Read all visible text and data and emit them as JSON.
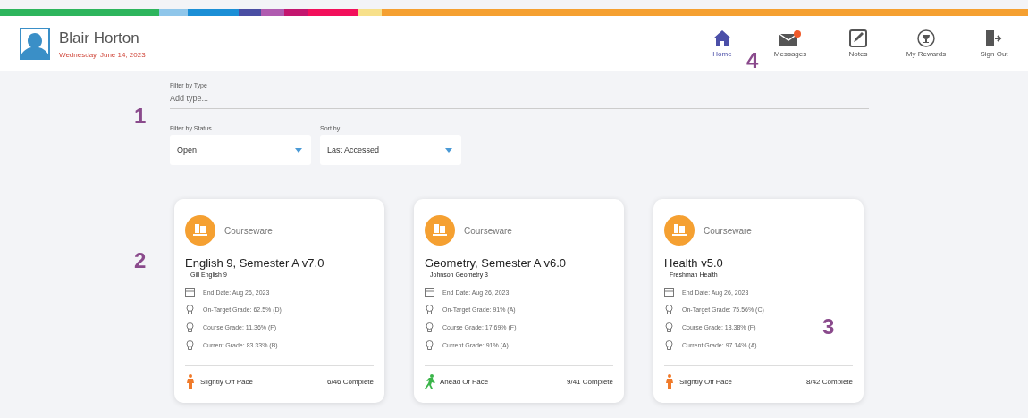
{
  "user": {
    "name": "Blair Horton",
    "date": "Wednesday, June 14, 2023"
  },
  "nav": [
    {
      "label": "Home",
      "kind": "home",
      "selected": true
    },
    {
      "label": "Messages",
      "kind": "messages",
      "selected": false,
      "unread": true
    },
    {
      "label": "Notes",
      "kind": "notes",
      "selected": false
    },
    {
      "label": "My Rewards",
      "kind": "rewards",
      "selected": false
    },
    {
      "label": "Sign Out",
      "kind": "signout",
      "selected": false
    }
  ],
  "filters": {
    "type_label": "Filter by Type",
    "type_placeholder": "Add type...",
    "status_label": "Filter by Status",
    "status_value": "Open",
    "sort_label": "Sort by",
    "sort_value": "Last Accessed"
  },
  "cards": [
    {
      "category": "Courseware",
      "title": "English 9, Semester A v7.0",
      "subtitle": "Gill English 9",
      "end_date": "End Date: Aug 26, 2023",
      "on_target": "On-Target Grade: 62.5% (D)",
      "course_grade": "Course Grade: 11.36% (F)",
      "current_grade": "Current Grade: 83.33% (B)",
      "pace": "Slightly Off Pace",
      "kind": "off",
      "complete": "6/46 Complete"
    },
    {
      "category": "Courseware",
      "title": "Geometry, Semester A v6.0",
      "subtitle": "Johnson Geometry 3",
      "end_date": "End Date: Aug 26, 2023",
      "on_target": "On-Target Grade: 91% (A)",
      "course_grade": "Course Grade: 17.69% (F)",
      "current_grade": "Current Grade: 91% (A)",
      "pace": "Ahead Of Pace",
      "kind": "ahead",
      "complete": "9/41 Complete"
    },
    {
      "category": "Courseware",
      "title": "Health v5.0",
      "subtitle": "Freshman Health",
      "end_date": "End Date: Aug 26, 2023",
      "on_target": "On-Target Grade: 75.56% (C)",
      "course_grade": "Course Grade: 18.38% (F)",
      "current_grade": "Current Grade: 97.14% (A)",
      "pace": "Slightly Off Pace",
      "kind": "off",
      "complete": "8/42 Complete"
    }
  ],
  "callouts": [
    "1",
    "2",
    "3",
    "4"
  ]
}
